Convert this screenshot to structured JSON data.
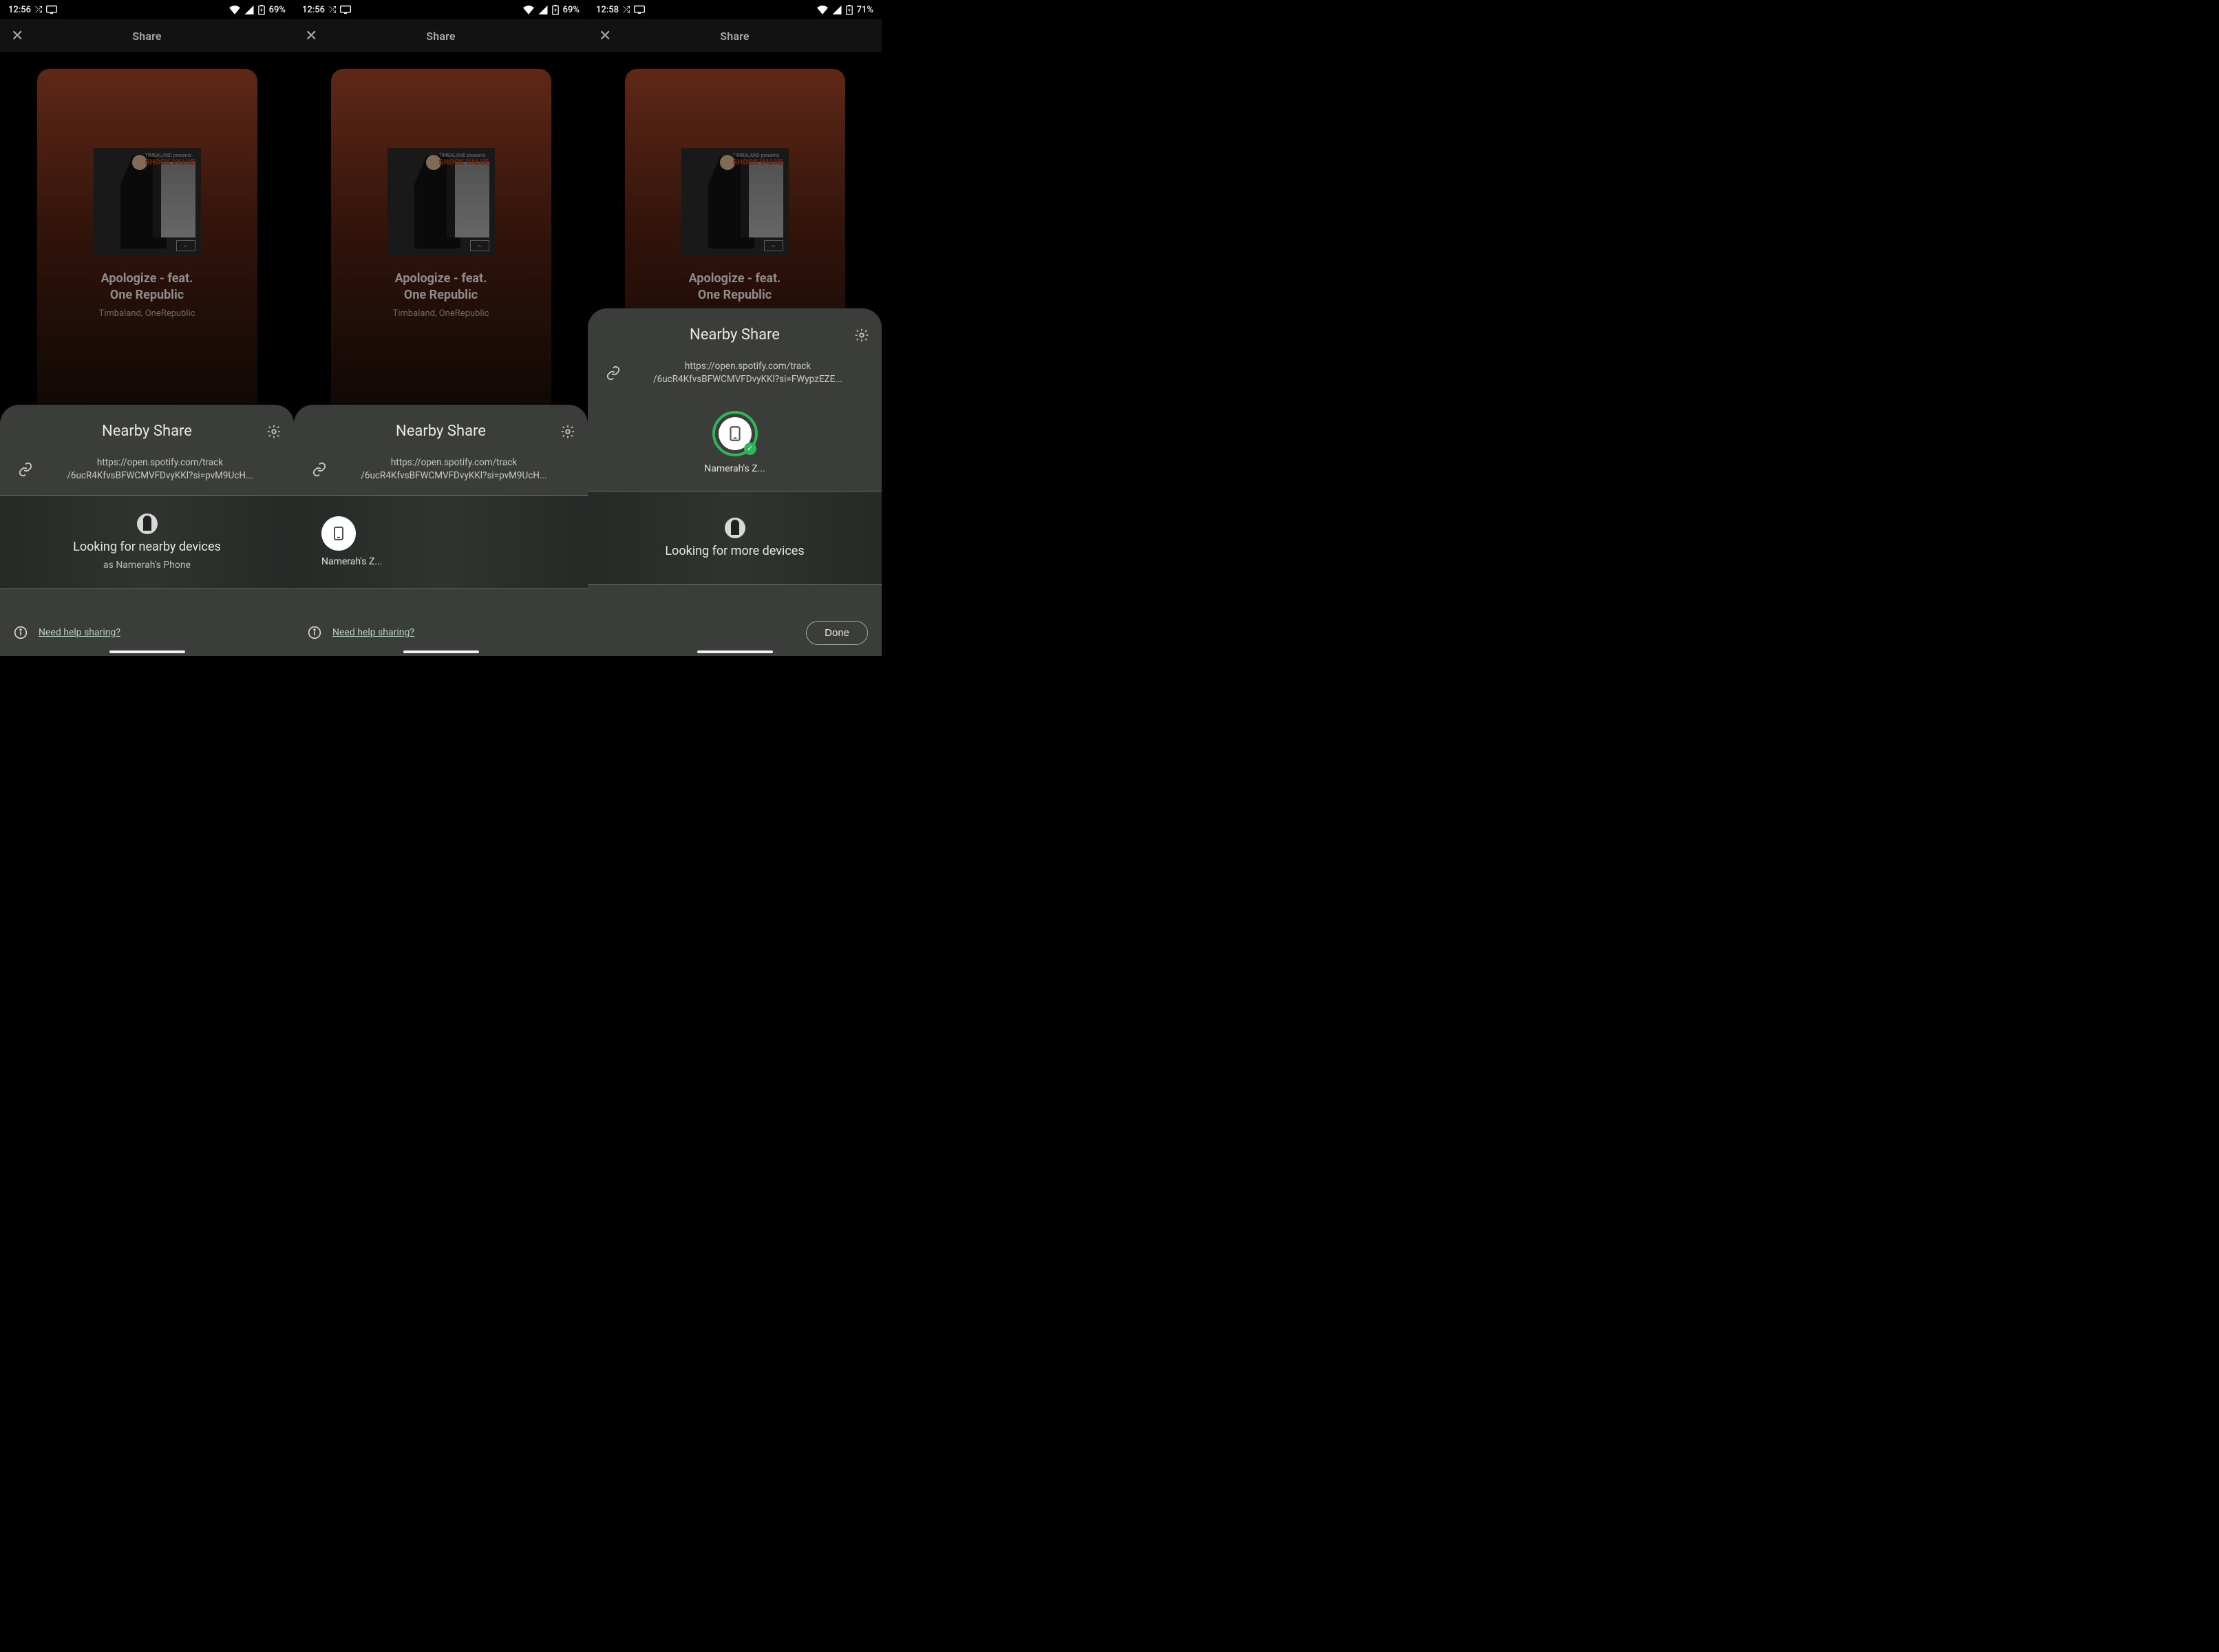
{
  "screens": [
    {
      "status": {
        "time": "12:56",
        "battery": "69%"
      },
      "share_header": {
        "title": "Share"
      },
      "song": {
        "title_l1": "Apologize - feat.",
        "title_l2": "One Republic",
        "artist": "Timbaland, OneRepublic",
        "album_pretitle": "TIMBALAND presents",
        "album_title": "SHOCK VALUE"
      },
      "nearby": {
        "title": "Nearby Share",
        "url_l1": "https://open.spotify.com/track",
        "url_l2": "/6ucR4KfvsBFWCMVFDvyKKl?si=pvM9UcH...",
        "looking": "Looking for nearby devices",
        "as": "as Namerah's Phone",
        "help": "Need help sharing?"
      }
    },
    {
      "status": {
        "time": "12:56",
        "battery": "69%"
      },
      "share_header": {
        "title": "Share"
      },
      "song": {
        "title_l1": "Apologize - feat.",
        "title_l2": "One Republic",
        "artist": "Timbaland, OneRepublic",
        "album_pretitle": "TIMBALAND presents",
        "album_title": "SHOCK VALUE"
      },
      "nearby": {
        "title": "Nearby Share",
        "url_l1": "https://open.spotify.com/track",
        "url_l2": "/6ucR4KfvsBFWCMVFDvyKKl?si=pvM9UcH...",
        "device_name": "Namerah's Z...",
        "help": "Need help sharing?"
      }
    },
    {
      "status": {
        "time": "12:58",
        "battery": "71%"
      },
      "share_header": {
        "title": "Share"
      },
      "song": {
        "title_l1": "Apologize - feat.",
        "title_l2": "One Republic",
        "artist": "Timbaland, OneRepublic",
        "album_pretitle": "TIMBALAND presents",
        "album_title": "SHOCK VALUE"
      },
      "nearby": {
        "title": "Nearby Share",
        "url_l1": "https://open.spotify.com/track",
        "url_l2": "/6ucR4KfvsBFWCMVFDvyKKl?si=FWypzEZE...",
        "chosen_device": "Namerah's Z...",
        "looking_more": "Looking for more devices",
        "done": "Done"
      }
    }
  ]
}
